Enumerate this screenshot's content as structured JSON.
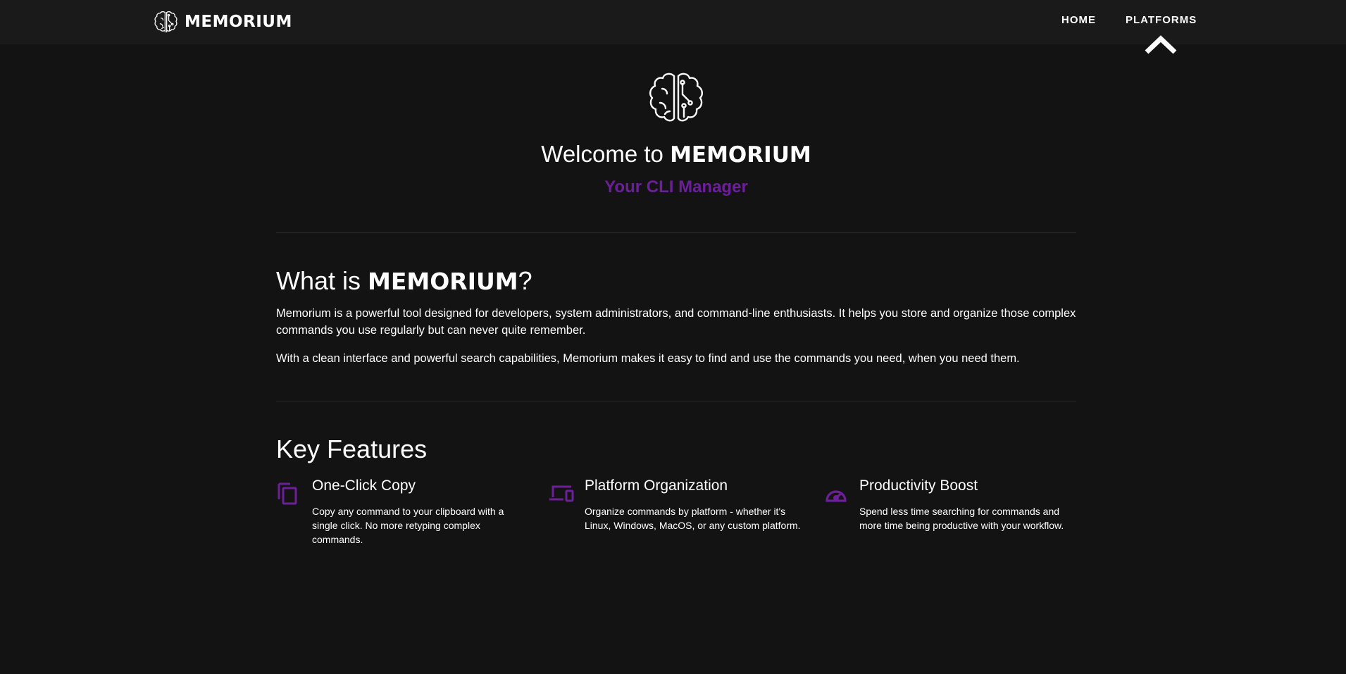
{
  "navbar": {
    "brand": "MEMORIUM",
    "links": [
      {
        "label": "HOME"
      },
      {
        "label": "PLATFORMS"
      }
    ]
  },
  "hero": {
    "title_prefix": "Welcome to ",
    "title_strong": "MEMORIUM",
    "subtitle": "Your CLI Manager"
  },
  "about": {
    "heading_prefix": "What is ",
    "heading_strong": "MEMORIUM",
    "heading_suffix": "?",
    "paragraphs": [
      "Memorium is a powerful tool designed for developers, system administrators, and command-line enthusiasts. It helps you store and organize those complex commands you use regularly but can never quite remember.",
      "With a clean interface and powerful search capabilities, Memorium makes it easy to find and use the commands you need, when you need them."
    ]
  },
  "features": {
    "heading": "Key Features",
    "items": [
      {
        "icon": "copy-icon",
        "title": "One-Click Copy",
        "description": "Copy any command to your clipboard with a single click. No more retyping complex commands."
      },
      {
        "icon": "devices-icon",
        "title": "Platform Organization",
        "description": "Organize commands by platform - whether it's Linux, Windows, MacOS, or any custom platform."
      },
      {
        "icon": "speedometer-icon",
        "title": "Productivity Boost",
        "description": "Spend less time searching for commands and more time being productive with your workflow."
      }
    ]
  },
  "colors": {
    "background": "#131313",
    "navbar": "#1a1a1a",
    "accent": "#6c1f99",
    "text": "#ffffff",
    "divider": "#2b2b2b"
  }
}
